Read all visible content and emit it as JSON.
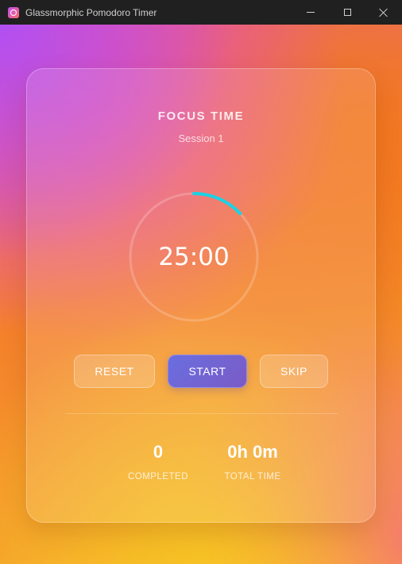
{
  "window": {
    "title": "Glassmorphic Pomodoro Timer"
  },
  "timer": {
    "mode_label": "FOCUS TIME",
    "session_label": "Session 1",
    "time_display": "25:00",
    "progress_fraction": 0.13,
    "progress_color": "#19d3e6"
  },
  "controls": {
    "reset_label": "RESET",
    "start_label": "START",
    "skip_label": "SKIP"
  },
  "stats": {
    "completed_value": "0",
    "completed_label": "COMPLETED",
    "total_value": "0h 0m",
    "total_label": "TOTAL TIME"
  }
}
